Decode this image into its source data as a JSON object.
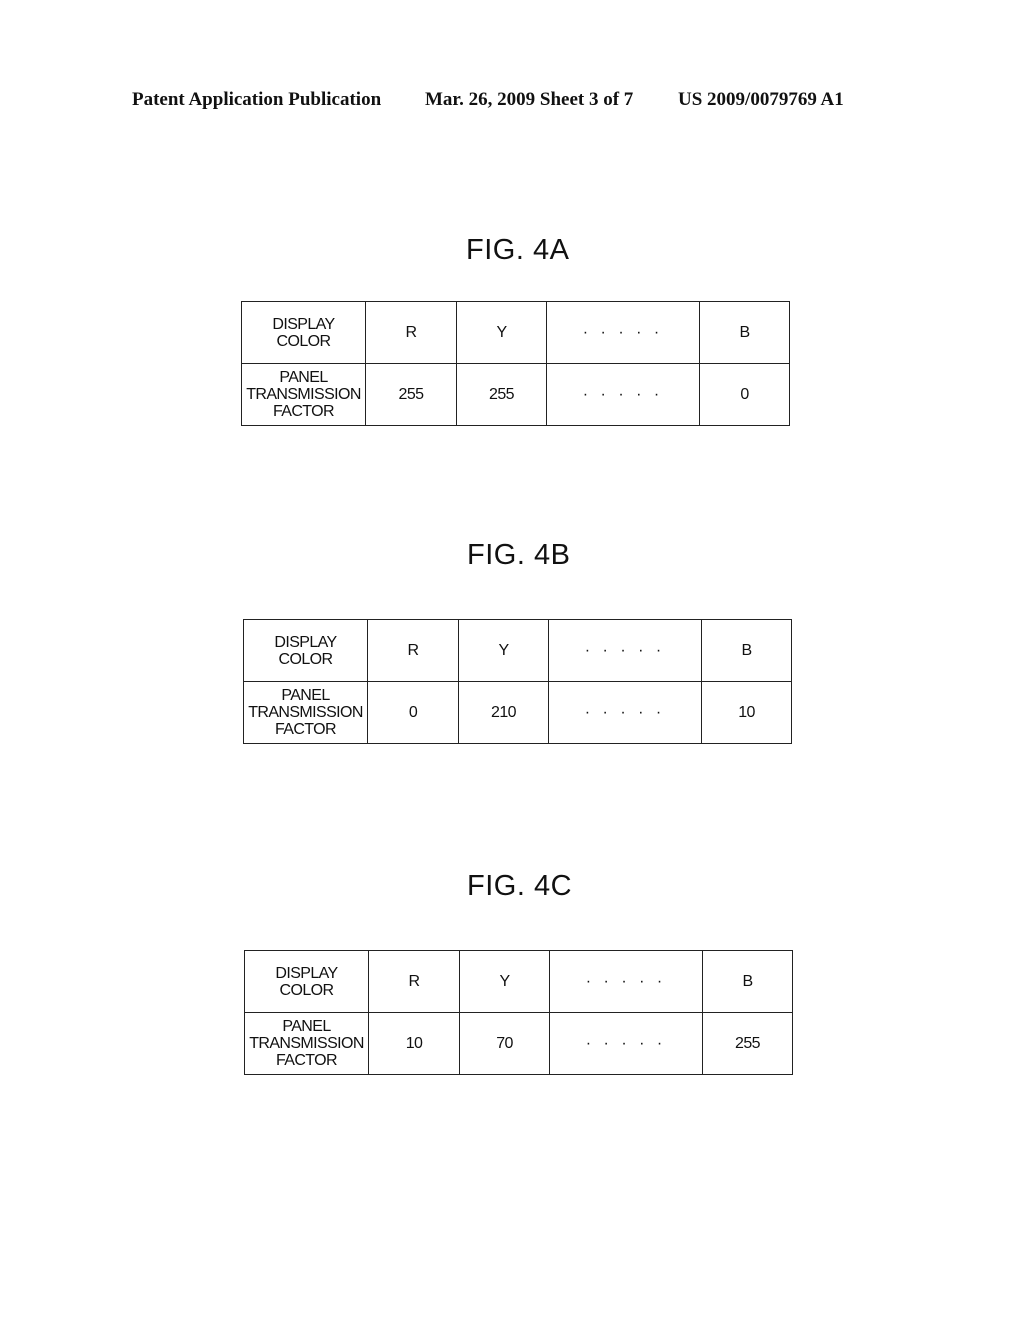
{
  "header": {
    "left": "Patent Application Publication",
    "middle": "Mar. 26, 2009  Sheet 3 of 7",
    "right": "US 2009/0079769 A1"
  },
  "figures": [
    {
      "title": "FIG. 4A",
      "row_headers": {
        "display_color": [
          "DISPLAY",
          "COLOR"
        ],
        "panel_transmission_factor": [
          "PANEL",
          "TRANSMISSION",
          "FACTOR"
        ]
      },
      "columns": [
        "R",
        "Y",
        "· · · · ·",
        "B"
      ],
      "values": [
        "255",
        "255",
        "· · · · ·",
        "0"
      ]
    },
    {
      "title": "FIG. 4B",
      "row_headers": {
        "display_color": [
          "DISPLAY",
          "COLOR"
        ],
        "panel_transmission_factor": [
          "PANEL",
          "TRANSMISSION",
          "FACTOR"
        ]
      },
      "columns": [
        "R",
        "Y",
        "· · · · ·",
        "B"
      ],
      "values": [
        "0",
        "210",
        "· · · · ·",
        "10"
      ]
    },
    {
      "title": "FIG. 4C",
      "row_headers": {
        "display_color": [
          "DISPLAY",
          "COLOR"
        ],
        "panel_transmission_factor": [
          "PANEL",
          "TRANSMISSION",
          "FACTOR"
        ]
      },
      "columns": [
        "R",
        "Y",
        "· · · · ·",
        "B"
      ],
      "values": [
        "10",
        "70",
        "· · · · ·",
        "255"
      ]
    }
  ]
}
